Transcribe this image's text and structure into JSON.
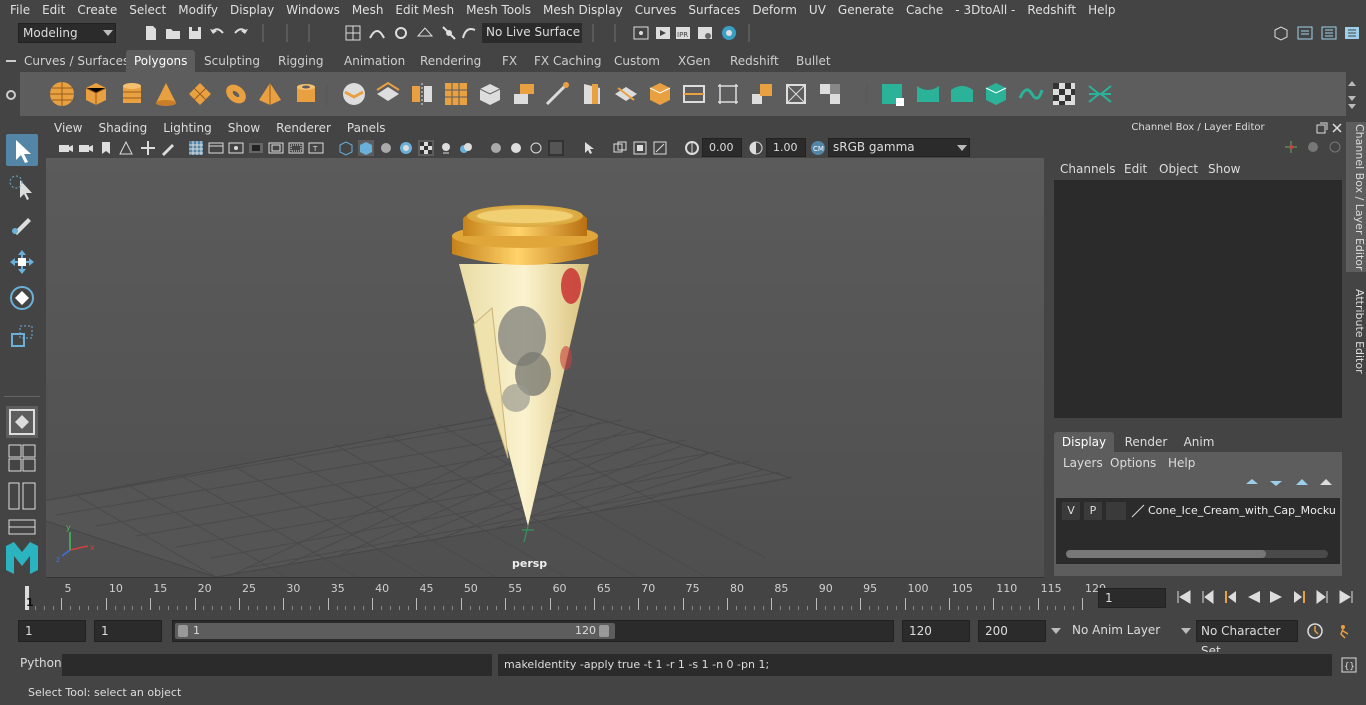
{
  "menubar": [
    "File",
    "Edit",
    "Create",
    "Select",
    "Modify",
    "Display",
    "Windows",
    "Mesh",
    "Edit Mesh",
    "Mesh Tools",
    "Mesh Display",
    "Curves",
    "Surfaces",
    "Deform",
    "UV",
    "Generate",
    "Cache",
    "- 3DtoAll -",
    "Redshift",
    "Help"
  ],
  "status": {
    "mode": "Modeling",
    "live_surface": "No Live Surface"
  },
  "shelf_tabs": [
    "Curves / Surfaces",
    "Polygons",
    "Sculpting",
    "Rigging",
    "Animation",
    "Rendering",
    "FX",
    "FX Caching",
    "Custom",
    "XGen",
    "Redshift",
    "Bullet"
  ],
  "shelf_active": "Polygons",
  "viewport": {
    "menus": [
      "View",
      "Shading",
      "Lighting",
      "Show",
      "Renderer",
      "Panels"
    ],
    "exposure": "0.00",
    "gamma": "1.00",
    "color_space": "sRGB gamma",
    "camera_label": "persp"
  },
  "channel_box": {
    "title": "Channel Box / Layer Editor",
    "menus": [
      "Channels",
      "Edit",
      "Object",
      "Show"
    ],
    "layer_tabs": [
      "Display",
      "Render",
      "Anim"
    ],
    "layer_tab_active": "Display",
    "layer_menus": [
      "Layers",
      "Options",
      "Help"
    ],
    "layer": {
      "v": "V",
      "p": "P",
      "name": "Cone_Ice_Cream_with_Cap_Mockup_"
    }
  },
  "side_tabs": [
    "Channel Box / Layer Editor",
    "Attribute Editor"
  ],
  "timeline": {
    "ticks": [
      "5",
      "10",
      "15",
      "20",
      "25",
      "30",
      "35",
      "40",
      "45",
      "50",
      "55",
      "60",
      "65",
      "70",
      "75",
      "80",
      "85",
      "90",
      "95",
      "100",
      "105",
      "110",
      "115",
      "120"
    ],
    "start_marker": "1",
    "current_frame": "1"
  },
  "range": {
    "start": "1",
    "start_inner": "1",
    "slider_start": "1",
    "slider_end": "120",
    "end_inner": "120",
    "end": "200",
    "anim_layer": "No Anim Layer",
    "character_set": "No Character Set"
  },
  "command": {
    "lang": "Python",
    "result": "makeIdentity -apply true -t 1 -r 1 -s 1 -n 0 -pn 1;"
  },
  "help_line": "Select Tool: select an object",
  "colors": {
    "orange_icon": "#e8a040",
    "teal_icon": "#2bb39a",
    "bg": "#444444",
    "viewport": "#5a5a5a"
  }
}
